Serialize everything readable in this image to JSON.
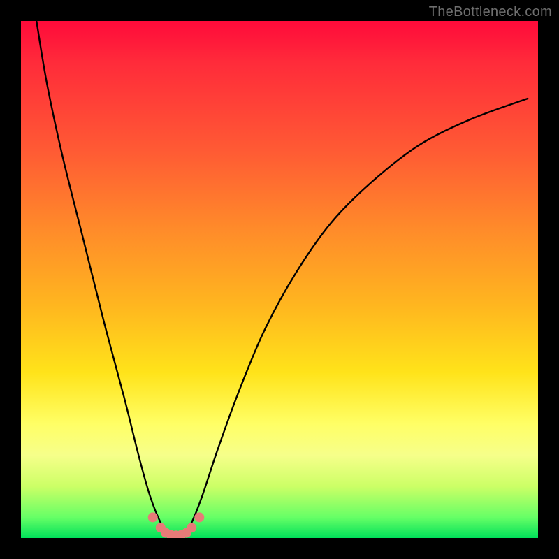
{
  "watermark": "TheBottleneck.com",
  "chart_data": {
    "type": "line",
    "title": "",
    "xlabel": "",
    "ylabel": "",
    "xlim": [
      0,
      100
    ],
    "ylim": [
      0,
      100
    ],
    "series": [
      {
        "name": "bottleneck-curve",
        "x": [
          3,
          5,
          8,
          12,
          16,
          20,
          23,
          25,
          27,
          28.5,
          30,
          31.5,
          33,
          35,
          38,
          42,
          47,
          53,
          60,
          68,
          77,
          87,
          98
        ],
        "y": [
          100,
          88,
          74,
          58,
          42,
          27,
          15,
          8,
          3,
          1,
          0.5,
          1,
          3,
          8,
          17,
          28,
          40,
          51,
          61,
          69,
          76,
          81,
          85
        ]
      }
    ],
    "markers": {
      "name": "valley-dots",
      "x": [
        25.5,
        27,
        28,
        29,
        30,
        31,
        32,
        33,
        34.5
      ],
      "y": [
        4,
        2,
        1,
        0.6,
        0.5,
        0.6,
        1,
        2,
        4
      ],
      "color": "#e77b78"
    },
    "gradient_stops": [
      {
        "pos": 0,
        "color": "#ff0a3a"
      },
      {
        "pos": 25,
        "color": "#ff5a34"
      },
      {
        "pos": 55,
        "color": "#ffb61f"
      },
      {
        "pos": 78,
        "color": "#ffff66"
      },
      {
        "pos": 100,
        "color": "#00e05a"
      }
    ]
  }
}
